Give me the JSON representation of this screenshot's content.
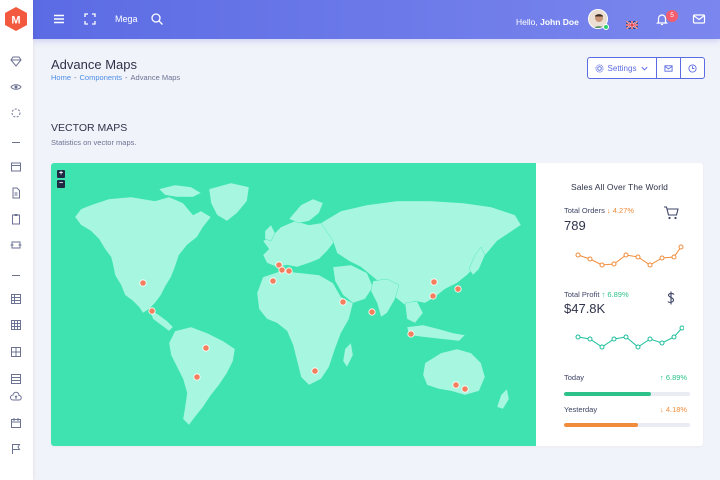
{
  "colors": {
    "header_start": "#5b6be3",
    "header_end": "#7b87ee",
    "map_bg": "#3fe3af",
    "land": "#a7f7e0",
    "marker": "#f47f5e",
    "up": "#2dc28a",
    "down": "#f08c3a",
    "sidebar_logo": "#f3593f"
  },
  "sidebar": {
    "icons": [
      "diamond-icon",
      "eye-icon",
      "loader-icon",
      "widget-icon",
      "document-icon",
      "clipboard-icon",
      "swap-icon",
      "table-icon",
      "grid-icon",
      "layout-icon",
      "list-icon",
      "cloud-upload-icon",
      "calendar-icon",
      "flag-icon"
    ]
  },
  "header": {
    "menu_icon": "menu-icon",
    "fullscreen_icon": "fullscreen-icon",
    "mega_label": "Mega",
    "search_icon": "search-icon",
    "greeting": "Hello,",
    "user_name": "John Doe",
    "notification_count": "5"
  },
  "page": {
    "title": "Advance Maps",
    "breadcrumb": [
      "Home",
      "Components",
      "Advance Maps"
    ],
    "settings_label": "Settings"
  },
  "section": {
    "title": "VECTOR MAPS",
    "subtitle": "Statistics on vector maps."
  },
  "map": {
    "zoom_in": "+",
    "zoom_out": "−"
  },
  "panel": {
    "title": "Sales All Over The World",
    "orders": {
      "label": "Total Orders",
      "change": "↓ 4.27%",
      "value": "789"
    },
    "profit": {
      "label": "Total Profit",
      "change": "↑ 6.89%",
      "value": "$47.8K"
    },
    "today": {
      "label": "Today",
      "change": "↑ 6.89%",
      "progress": 0.69
    },
    "yesterday": {
      "label": "Yesterday",
      "change": "↓ 4.18%",
      "progress": 0.59
    }
  }
}
